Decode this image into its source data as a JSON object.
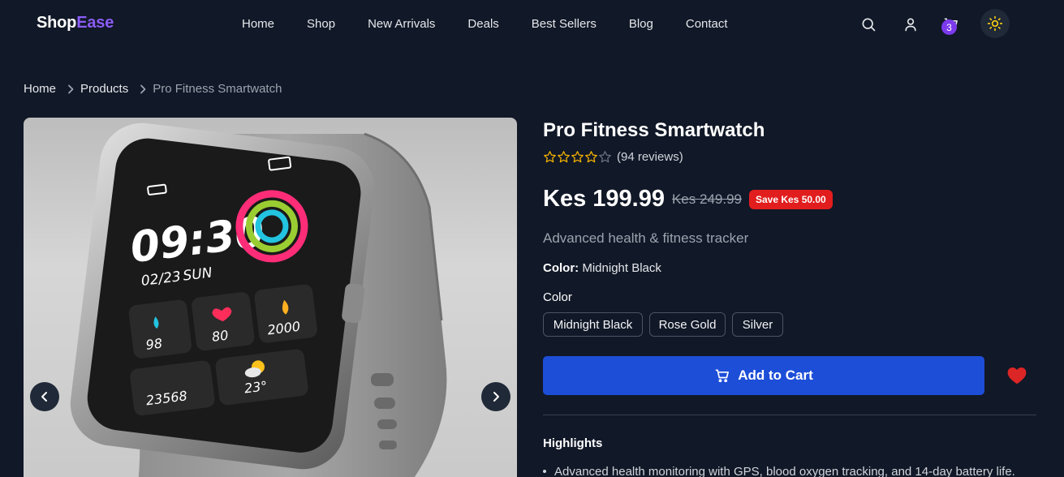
{
  "brand": {
    "part1": "Shop",
    "part2": "Ease"
  },
  "nav": [
    {
      "label": "Home"
    },
    {
      "label": "Shop"
    },
    {
      "label": "New Arrivals"
    },
    {
      "label": "Deals"
    },
    {
      "label": "Best Sellers"
    },
    {
      "label": "Blog"
    },
    {
      "label": "Contact"
    }
  ],
  "header_icons": [
    "search-icon",
    "user-icon",
    "cart-icon",
    "sun-icon"
  ],
  "cart_count": "3",
  "breadcrumb": [
    "Home",
    "Products",
    "Pro Fitness Smartwatch"
  ],
  "product": {
    "title": "Pro Fitness Smartwatch",
    "rating": 4,
    "rating_max": 5,
    "reviews": "(94 reviews)",
    "price": "Kes 199.99",
    "old_price": "Kes 249.99",
    "save_badge": "Save Kes 50.00",
    "subtitle": "Advanced health & fitness tracker",
    "selected_color_key": "Color:",
    "selected_color_value": "Midnight Black",
    "color_label": "Color",
    "colors": [
      "Midnight Black",
      "Rose Gold",
      "Silver"
    ],
    "add_to_cart": "Add to Cart",
    "highlights_title": "Highlights",
    "highlights": [
      "Advanced health monitoring with GPS, blood oxygen tracking, and 14-day battery life."
    ]
  },
  "watch_screen": {
    "time": "09:30",
    "date": "02/23",
    "day": "SUN",
    "stat1": "98",
    "stat2": "80",
    "stat3": "2000",
    "steps": "23568",
    "temp": "23°"
  },
  "colors": {
    "background": "#111827",
    "accent_purple": "#8b5cf6",
    "cart_button": "#1d4ed8",
    "save_badge": "#e11d1d",
    "star": "#f5b301",
    "heart": "#dc2626"
  }
}
